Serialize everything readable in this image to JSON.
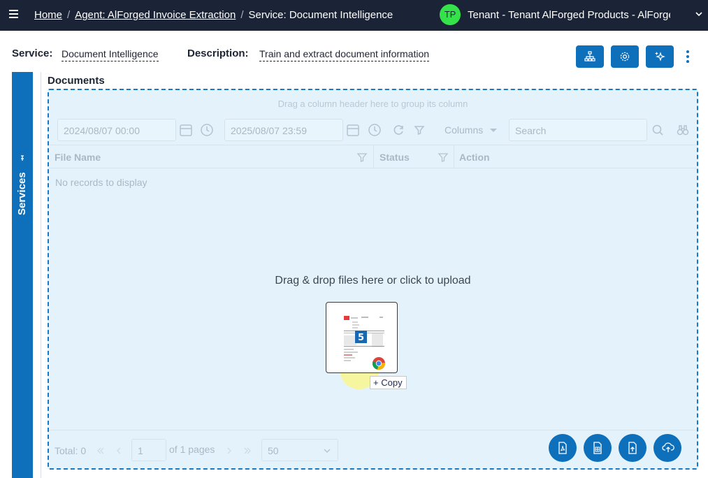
{
  "topbar": {
    "breadcrumbs": [
      {
        "label": "Home"
      },
      {
        "label": "Agent: AlForged Invoice Extraction"
      }
    ],
    "current": "Service: Document Intelligence",
    "avatar_initials": "TP",
    "tenant": "Tenant - Tenant AlForged Products - AlForge..."
  },
  "header": {
    "service_label": "Service:",
    "service_value": "Document Intelligence",
    "description_label": "Description:",
    "description_value": "Train and extract document information"
  },
  "sidepanel": {
    "label": "Services"
  },
  "documents": {
    "title": "Documents",
    "group_hint": "Drag a column header here to group its column",
    "date_from": "2024/08/07 00:00",
    "date_to": "2025/08/07 23:59",
    "columns_label": "Columns",
    "search_placeholder": "Search",
    "columns": [
      "File Name",
      "Status",
      "Action"
    ],
    "empty_text": "No records to display",
    "drop_text": "Drag & drop files here or click to upload",
    "drag_count": "5",
    "copy_label": "Copy",
    "pager": {
      "total": "Total: 0",
      "page": "1",
      "of_pages": "of 1 pages",
      "page_size": "50"
    }
  },
  "colors": {
    "topbar": "#1b2337",
    "accent": "#0e6fba",
    "dropzone_bg": "#e4f3fb",
    "avatar": "#34e24a"
  }
}
